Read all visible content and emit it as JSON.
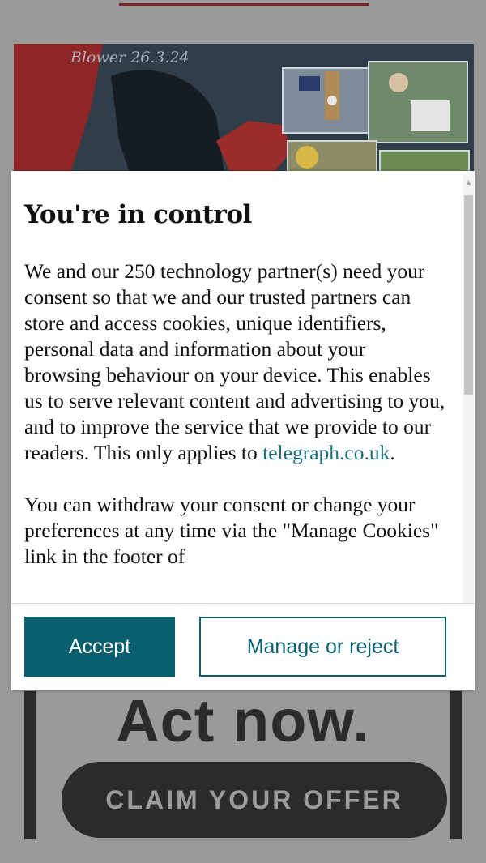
{
  "page": {
    "cartoon_signature": "Blower 26.3.24",
    "promo_headline": "Act now.",
    "offer_button_label": "CLAIM YOUR OFFER"
  },
  "consent": {
    "title": "You're in control",
    "paragraph1_text": "We and our 250 technology partner(s) need your consent so that we and our trusted partners can store and access cookies, unique identifiers, personal data and information about your browsing behaviour on your device. This enables us to serve relevant content and advertising to you, and to improve the service that we provide to our readers. This only applies to ",
    "paragraph1_link": "telegraph.co.uk",
    "paragraph1_end": ".",
    "paragraph2_text": "You can withdraw your consent or change your preferences at any time via the \"Manage Cookies\" link in the footer of",
    "accept_label": "Accept",
    "manage_label": "Manage or reject"
  },
  "colors": {
    "accent": "#0a5f6e",
    "link": "#1d6e7c",
    "overlay": "#9a9a9a",
    "promo_dark": "#2b2b2b"
  },
  "icons": {
    "scroll_up": "triangle-up-icon"
  }
}
